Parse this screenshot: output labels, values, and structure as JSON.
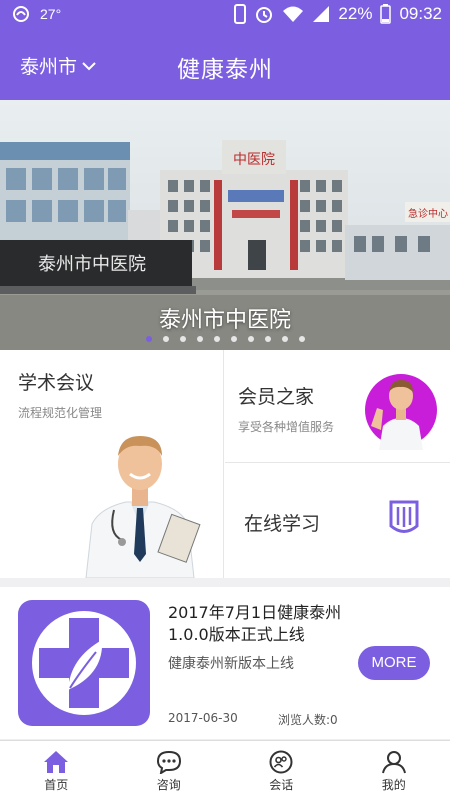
{
  "status_bar": {
    "temperature": "27°",
    "battery": "22%",
    "time": "09:32"
  },
  "header": {
    "city": "泰州市",
    "title": "健康泰州"
  },
  "banner": {
    "caption": "泰州市中医院",
    "sign_left": "泰州市中医院",
    "building_sign": "中医院",
    "sign_right": "急诊中心",
    "dot_count": 10,
    "active_dot": 0
  },
  "grid": {
    "academic": {
      "title": "学术会议",
      "subtitle": "流程规范化管理"
    },
    "member": {
      "title": "会员之家",
      "subtitle": "享受各种增值服务"
    },
    "learning": {
      "title": "在线学习"
    }
  },
  "news": {
    "title": "2017年7月1日健康泰州1.0.0版本正式上线",
    "subtitle": "健康泰州新版本上线",
    "date": "2017-06-30",
    "views": "浏览人数:0",
    "more_label": "MORE"
  },
  "tabs": [
    {
      "label": "首页",
      "icon": "home-icon",
      "active": true
    },
    {
      "label": "咨询",
      "icon": "chat-icon",
      "active": false
    },
    {
      "label": "会话",
      "icon": "conversation-icon",
      "active": false
    },
    {
      "label": "我的",
      "icon": "user-icon",
      "active": false
    }
  ],
  "colors": {
    "primary": "#7b5fe0",
    "member_circle": "#c81ed9"
  }
}
